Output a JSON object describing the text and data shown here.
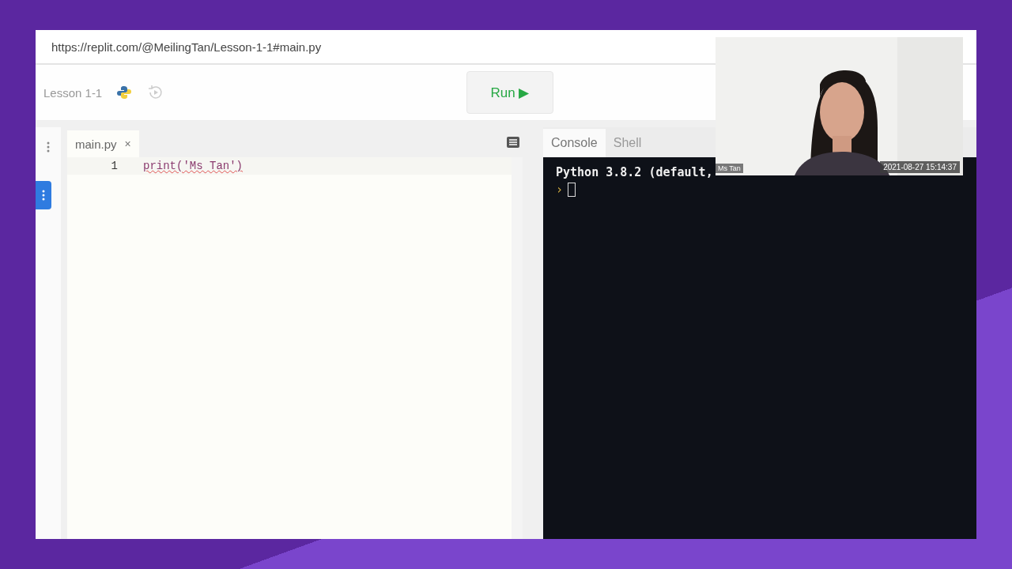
{
  "browser": {
    "url": "https://replit.com/@MeilingTan/Lesson-1-1#main.py"
  },
  "header": {
    "repl_name": "Lesson 1-1",
    "run_button": "Run ▶"
  },
  "editor": {
    "tabs": [
      {
        "label": "main.py",
        "close": "×",
        "selected": true
      }
    ],
    "lines": [
      {
        "number": "1",
        "code": "print('Ms Tan')"
      }
    ]
  },
  "console": {
    "tabs": [
      {
        "label": "Console",
        "selected": true
      },
      {
        "label": "Shell",
        "selected": false
      }
    ],
    "output": "Python 3.8.2 (default,",
    "prompt": "›"
  },
  "webcam": {
    "kind": "picture",
    "name_tag": "Ms Tan",
    "timestamp": "2021-08-27 15:14:37"
  }
}
